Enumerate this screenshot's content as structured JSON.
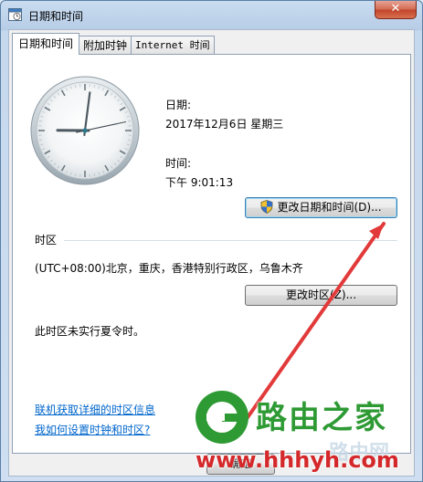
{
  "window": {
    "title": "日期和时间"
  },
  "tabs": [
    {
      "label": "日期和时间"
    },
    {
      "label": "附加时钟"
    },
    {
      "label": "Internet 时间"
    }
  ],
  "datetime": {
    "date_label": "日期:",
    "date_value": "2017年12月6日 星期三",
    "time_label": "时间:",
    "time_value": "下午 9:01:13",
    "change_button": "更改日期和时间(D)..."
  },
  "clock": {
    "hour": 9,
    "minute": 1,
    "second": 13
  },
  "timezone": {
    "heading": "时区",
    "value": "(UTC+08:00)北京，重庆，香港特别行政区，乌鲁木齐",
    "change_button": "更改时区(Z)...",
    "dst_note": "此时区未实行夏令时。"
  },
  "links": {
    "online_info": "联机获取详细的时区信息",
    "how_to": "我如何设置时钟和时区?"
  },
  "footer": {
    "ok_label": "确定"
  },
  "watermark": {
    "brand": "路由之家",
    "url": "www.hhhyh.com",
    "faint_text": "路由网",
    "arrow_color": "#e23a3a",
    "brand_color": "#2e9a34"
  }
}
